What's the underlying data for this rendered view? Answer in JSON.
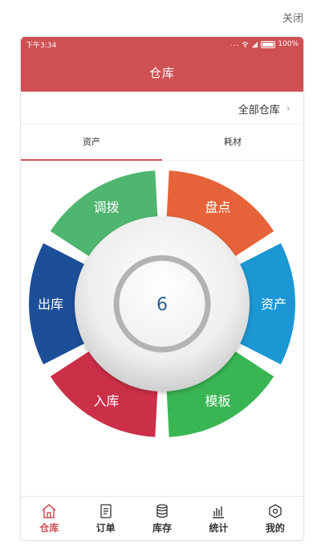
{
  "close_label": "关闭",
  "status_bar": {
    "time": "下午3:34",
    "signal": "...",
    "battery": "100%"
  },
  "header": {
    "title": "仓库"
  },
  "warehouse_selector": {
    "label": "全部仓库",
    "chevron": "›"
  },
  "tabs": [
    {
      "label": "资产",
      "active": true
    },
    {
      "label": "耗材",
      "active": false
    }
  ],
  "wheel": {
    "center_value": "6",
    "segments": [
      {
        "label": "调拨",
        "color": "#4fb66f"
      },
      {
        "label": "盘点",
        "color": "#e6633a"
      },
      {
        "label": "资产",
        "color": "#1b97d4"
      },
      {
        "label": "模板",
        "color": "#3ab553"
      },
      {
        "label": "入库",
        "color": "#cc2f48"
      },
      {
        "label": "出库",
        "color": "#1d4f99"
      }
    ]
  },
  "bottom_nav": [
    {
      "label": "仓库",
      "icon": "warehouse-icon",
      "active": true
    },
    {
      "label": "订单",
      "icon": "order-icon",
      "active": false
    },
    {
      "label": "库存",
      "icon": "stock-icon",
      "active": false
    },
    {
      "label": "统计",
      "icon": "chart-icon",
      "active": false
    },
    {
      "label": "我的",
      "icon": "profile-icon",
      "active": false
    }
  ],
  "colors": {
    "brand": "#cf5053"
  }
}
